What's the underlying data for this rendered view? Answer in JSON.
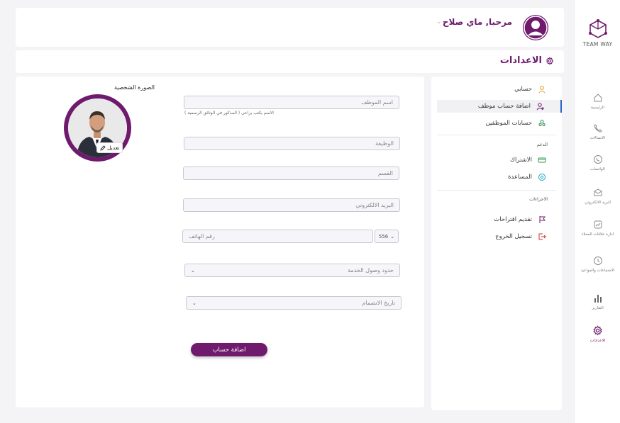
{
  "app": {
    "logo_text": "TEAM WAY"
  },
  "rail": {
    "items": [
      {
        "label": "الرئيسية",
        "icon": "home-icon"
      },
      {
        "label": "الاتصالات",
        "icon": "phone-icon"
      },
      {
        "label": "الواتساب",
        "icon": "whatsapp-icon"
      },
      {
        "label": "البريد الالكتروني",
        "icon": "mail-icon"
      },
      {
        "label": "ادارة علاقات العملاء",
        "icon": "crm-icon"
      },
      {
        "label": "الاجتماعات والمواعيد",
        "icon": "clock-icon"
      },
      {
        "label": "التقارير",
        "icon": "bar-chart-icon"
      },
      {
        "label": "الاعدادات",
        "icon": "gear-icon"
      }
    ]
  },
  "header": {
    "greeting": "مرحبا, ماي صلاح"
  },
  "page": {
    "title": "الاعدادات"
  },
  "menu": {
    "account": [
      {
        "label": "حسابي",
        "icon": "user-icon"
      },
      {
        "label": "اضافة حساب موظف",
        "icon": "user-add-icon"
      },
      {
        "label": "حسابات الموظفين",
        "icon": "users-icon"
      }
    ],
    "support_heading": "الدعم",
    "support": [
      {
        "label": "الاشتراك",
        "icon": "card-icon"
      },
      {
        "label": "المساعدة",
        "icon": "help-icon"
      }
    ],
    "actions_heading": "الاجراءات",
    "actions": [
      {
        "label": "تقديم اقتراحات",
        "icon": "flag-icon"
      },
      {
        "label": "تسجيل الخروج",
        "icon": "logout-icon"
      }
    ]
  },
  "form": {
    "photo_label": "الصورة الشخصية",
    "edit_label": "تعديل",
    "employee_name": "اسم الموظف",
    "name_hint": "الاسم يكتب يراعي ( المذكور في الوثائق الرسمية )",
    "job": "الوظيفة",
    "department": "القسم",
    "email": "البريد الالكتروني",
    "phone_code": "556",
    "phone": "رقم الهاتف",
    "service_access": "حدود وصول الخدمة",
    "join_date": "تاريخ الانضمام",
    "submit": "اضافة حساب"
  },
  "colors": {
    "accent": "#6f1a6d",
    "active_bar": "#2a66c8"
  }
}
